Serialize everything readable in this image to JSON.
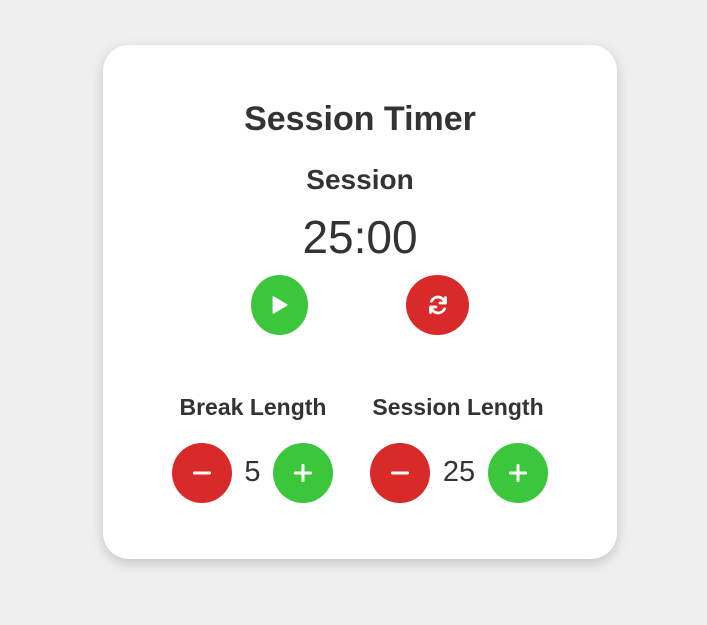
{
  "timer": {
    "title": "Session Timer",
    "mode_label": "Session",
    "time_display": "25:00"
  },
  "controls": {
    "start_icon": "play-icon",
    "reset_icon": "refresh-icon"
  },
  "break_length": {
    "label": "Break Length",
    "value": "5",
    "decrement_icon": "minus-icon",
    "increment_icon": "plus-icon"
  },
  "session_length": {
    "label": "Session Length",
    "value": "25",
    "decrement_icon": "minus-icon",
    "increment_icon": "plus-icon"
  },
  "colors": {
    "background": "#efefef",
    "card": "#ffffff",
    "text": "#333333",
    "start_green": "#3cc63c",
    "stop_red": "#d92a2a"
  }
}
